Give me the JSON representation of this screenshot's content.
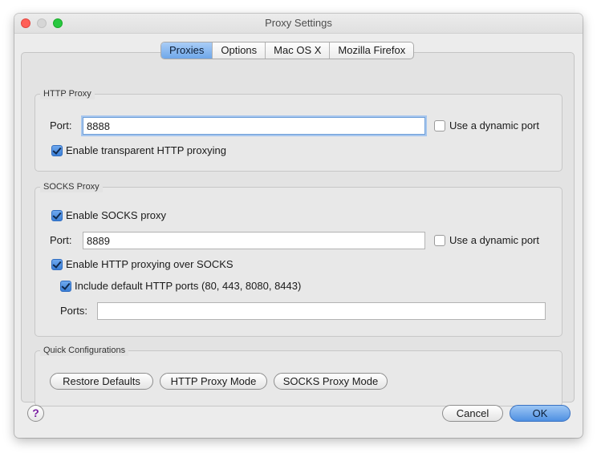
{
  "window": {
    "title": "Proxy Settings"
  },
  "tabs": [
    {
      "label": "Proxies",
      "active": true
    },
    {
      "label": "Options",
      "active": false
    },
    {
      "label": "Mac OS X",
      "active": false
    },
    {
      "label": "Mozilla Firefox",
      "active": false
    }
  ],
  "http_proxy": {
    "group_title": "HTTP Proxy",
    "port_label": "Port:",
    "port_value": "8888",
    "dynamic_port_label": "Use a dynamic port",
    "dynamic_port_checked": false,
    "transparent_label": "Enable transparent HTTP proxying",
    "transparent_checked": true
  },
  "socks_proxy": {
    "group_title": "SOCKS Proxy",
    "enable_label": "Enable SOCKS proxy",
    "enable_checked": true,
    "port_label": "Port:",
    "port_value": "8889",
    "dynamic_port_label": "Use a dynamic port",
    "dynamic_port_checked": false,
    "http_over_socks_label": "Enable HTTP proxying over SOCKS",
    "http_over_socks_checked": true,
    "include_default_label": "Include default HTTP ports (80, 443, 8080, 8443)",
    "include_default_checked": true,
    "ports_label": "Ports:",
    "ports_value": ""
  },
  "quick_config": {
    "group_title": "Quick Configurations",
    "restore_label": "Restore Defaults",
    "http_mode_label": "HTTP Proxy Mode",
    "socks_mode_label": "SOCKS Proxy Mode"
  },
  "footer": {
    "help_label": "?",
    "cancel_label": "Cancel",
    "ok_label": "OK"
  },
  "colors": {
    "accent": "#4f90e2",
    "help_icon": "#7a1fa2"
  }
}
